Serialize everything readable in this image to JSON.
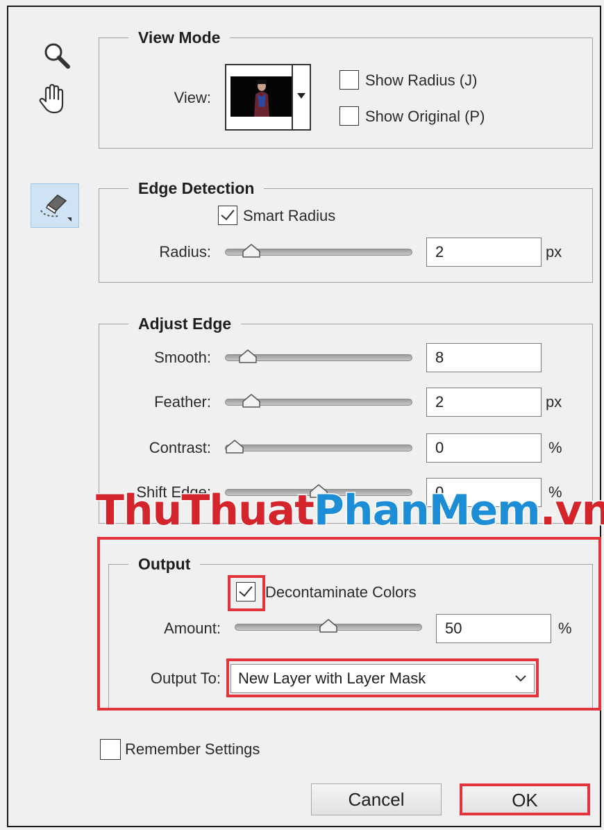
{
  "tools": {
    "zoom_icon": "zoom-icon",
    "hand_icon": "hand-icon",
    "refine_radius_icon": "refine-radius-icon"
  },
  "view_mode": {
    "title": "View Mode",
    "view_label": "View:",
    "show_radius": {
      "label": "Show Radius (J)",
      "checked": false
    },
    "show_original": {
      "label": "Show Original (P)",
      "checked": false
    }
  },
  "edge_detection": {
    "title": "Edge Detection",
    "smart_radius": {
      "label": "Smart Radius",
      "checked": true
    },
    "radius": {
      "label": "Radius:",
      "value": "2",
      "unit": "px",
      "slider_fraction": 0.1
    }
  },
  "adjust_edge": {
    "title": "Adjust Edge",
    "smooth": {
      "label": "Smooth:",
      "value": "8",
      "unit": "",
      "slider_fraction": 0.08
    },
    "feather": {
      "label": "Feather:",
      "value": "2",
      "unit": "px",
      "slider_fraction": 0.1
    },
    "contrast": {
      "label": "Contrast:",
      "value": "0",
      "unit": "%",
      "slider_fraction": 0.0
    },
    "shift_edge": {
      "label": "Shift Edge:",
      "value": "0",
      "unit": "%",
      "slider_fraction": 0.5
    }
  },
  "output": {
    "title": "Output",
    "decontaminate": {
      "label": "Decontaminate Colors",
      "checked": true
    },
    "amount": {
      "label": "Amount:",
      "value": "50",
      "unit": "%",
      "slider_fraction": 0.5
    },
    "output_to": {
      "label": "Output To:",
      "selected": "New Layer with Layer Mask"
    }
  },
  "remember_settings": {
    "label": "Remember Settings",
    "checked": false
  },
  "buttons": {
    "cancel": "Cancel",
    "ok": "OK"
  },
  "watermark": {
    "part1": "ThuThuat",
    "part2": "PhanMem",
    "part3": ".vn"
  },
  "colors": {
    "highlight": "#e3333d",
    "watermark_red": "#d4252d",
    "watermark_blue": "#1d8ed6"
  }
}
